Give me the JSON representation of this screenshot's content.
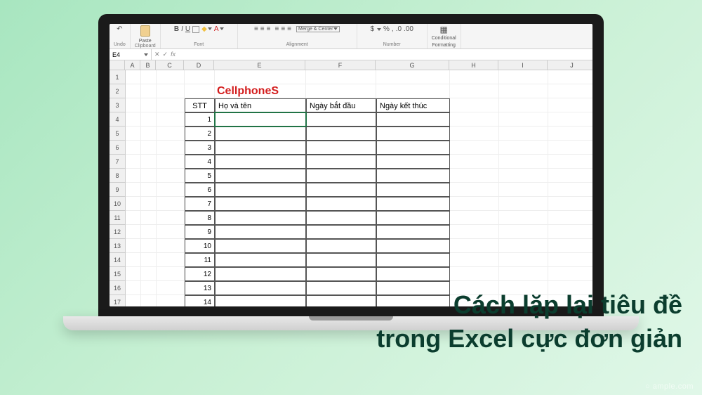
{
  "ribbon": {
    "undo_label": "Undo",
    "paste_label": "Paste",
    "clipboard_label": "Clipboard",
    "font_label": "Font",
    "alignment_label": "Alignment",
    "merge_label": "Merge & Center",
    "number_label": "Number",
    "percent_sign": "%",
    "comma_sign": ",",
    "currency_sign": "$",
    "dec_inc": ".0",
    "dec_dec": ".00",
    "cond_fmt_line1": "Conditional",
    "cond_fmt_line2": "Formatting",
    "bold": "B",
    "italic": "I",
    "underline": "U"
  },
  "formula": {
    "cell_ref": "E4",
    "fx": "fx",
    "check": "✓",
    "cross": "✕"
  },
  "columns": [
    "A",
    "B",
    "C",
    "D",
    "E",
    "F",
    "G",
    "H",
    "I",
    "J"
  ],
  "rows": [
    "1",
    "2",
    "3",
    "4",
    "5",
    "6",
    "7",
    "8",
    "9",
    "10",
    "11",
    "12",
    "13",
    "14",
    "15",
    "16",
    "17"
  ],
  "sheet": {
    "title": "CellphoneS",
    "headers": {
      "stt": "STT",
      "name": "Họ và tên",
      "start": "Ngày bắt đầu",
      "end": "Ngày kết thúc"
    },
    "stt_values": [
      "1",
      "2",
      "3",
      "4",
      "5",
      "6",
      "7",
      "8",
      "9",
      "10",
      "11",
      "12",
      "13",
      "14"
    ]
  },
  "overlay": {
    "line1": "Cách lặp lại tiêu đề",
    "line2": "trong Excel cực đơn giản"
  },
  "watermark": "○ ample.com"
}
